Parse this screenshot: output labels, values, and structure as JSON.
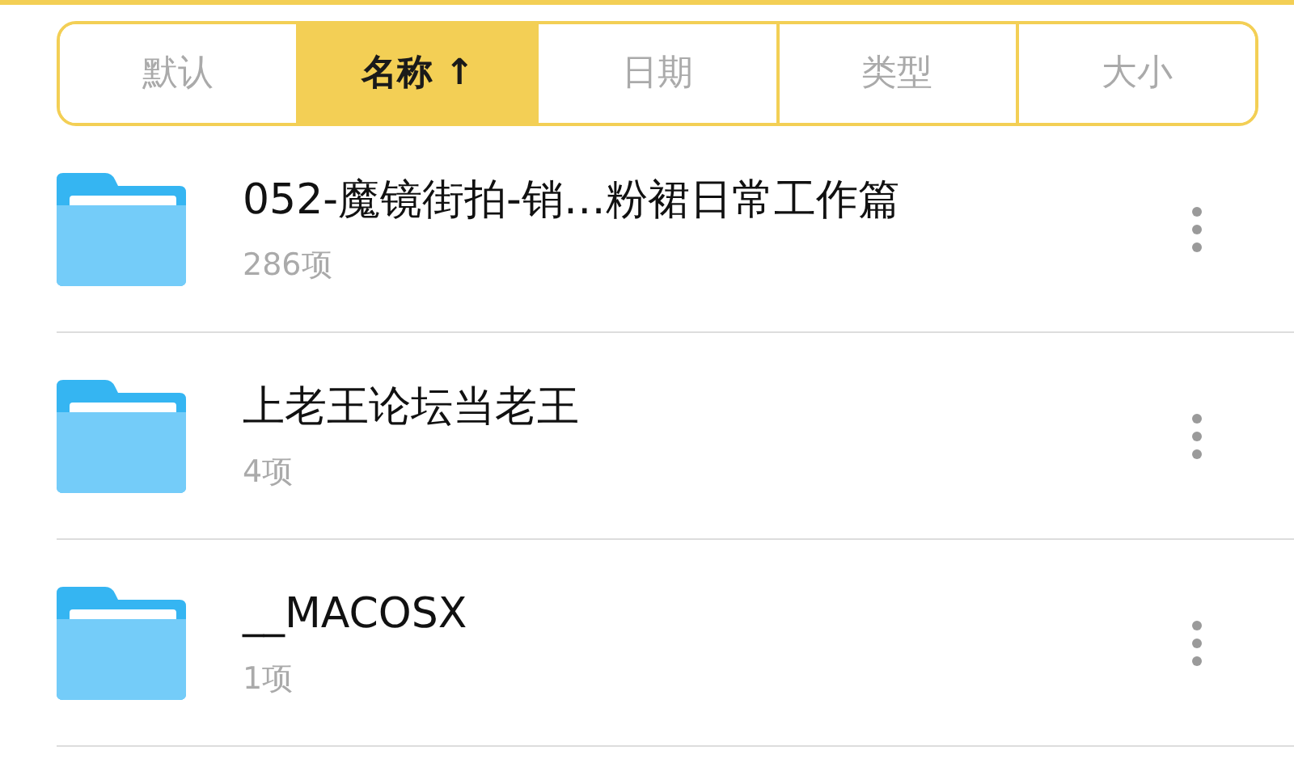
{
  "sort_tabs": [
    {
      "label": "默认",
      "selected": false
    },
    {
      "label": "名称 ↑",
      "selected": true
    },
    {
      "label": "日期",
      "selected": false
    },
    {
      "label": "类型",
      "selected": false
    },
    {
      "label": "大小",
      "selected": false
    }
  ],
  "folders": [
    {
      "name": "052-魔镜街拍-销…粉裙日常工作篇",
      "count": "286项"
    },
    {
      "name": "上老王论坛当老王",
      "count": "4项"
    },
    {
      "name": "__MACOSX",
      "count": "1项"
    }
  ]
}
